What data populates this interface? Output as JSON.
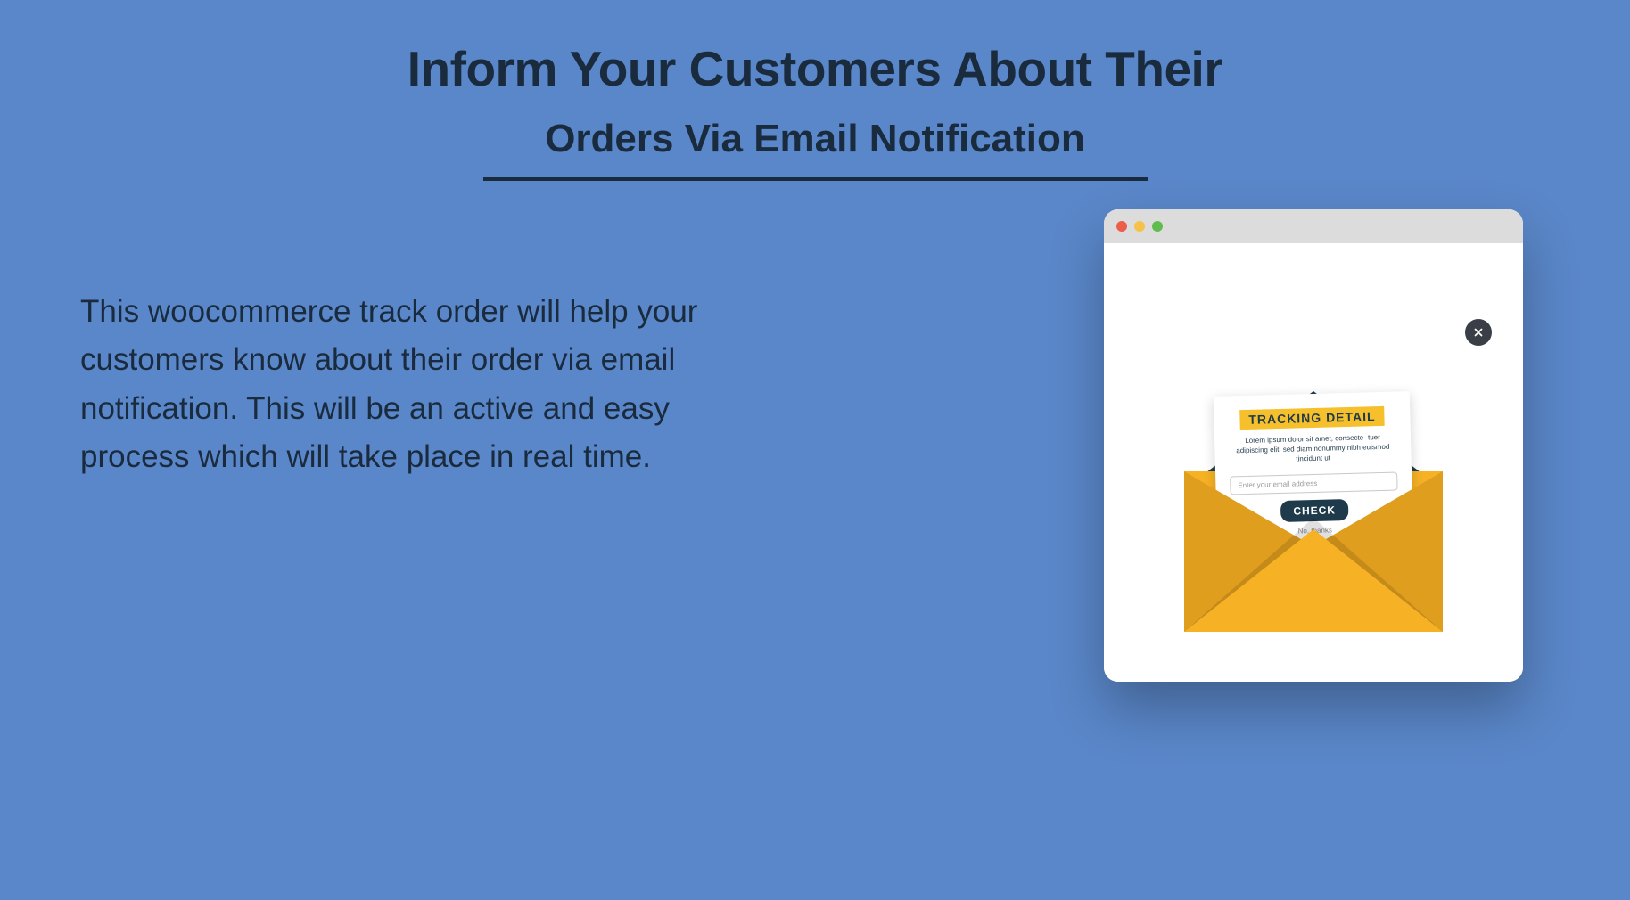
{
  "heading": {
    "line1": "Inform Your Customers About Their",
    "line2": "Orders Via Email Notification"
  },
  "description": "This woocommerce track order will help your customers know about their order via email notification. This will be an active and easy process which will take place in real time.",
  "popup": {
    "title": "TRACKING DETAIL",
    "lorem": "Lorem ipsum dolor sit amet, consecte- tuer adipiscing elit, sed diam nonummy nibh euismod tincidunt ut",
    "placeholder": "Enter your email address",
    "button": "CHECK",
    "dismiss": "No, thanks"
  }
}
